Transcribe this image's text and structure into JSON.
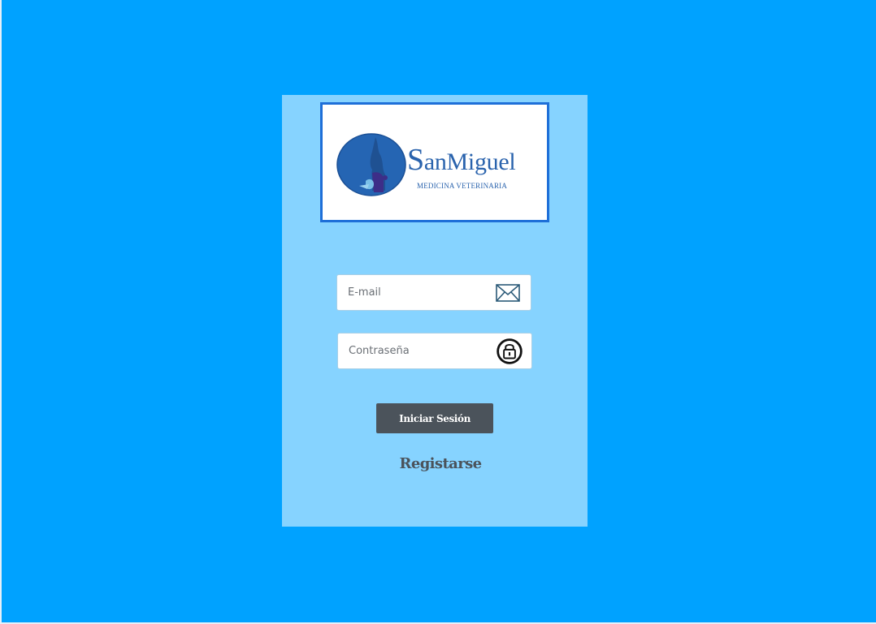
{
  "logo": {
    "name_initial": "S",
    "name_rest": "anMiguel",
    "tagline": "MEDICINA VETERINARIA"
  },
  "login": {
    "email_placeholder": "E-mail",
    "email_icon": "envelope-icon",
    "password_placeholder": "Contraseña",
    "password_icon": "lock-icon",
    "submit_label": "Iniciar Sesión",
    "register_label": "Registarse"
  },
  "colors": {
    "background": "#00a2ff",
    "card": "#86d3ff",
    "logo_border": "#1e6fd8",
    "button": "#4b535b",
    "brand_text": "#2a63ad"
  }
}
